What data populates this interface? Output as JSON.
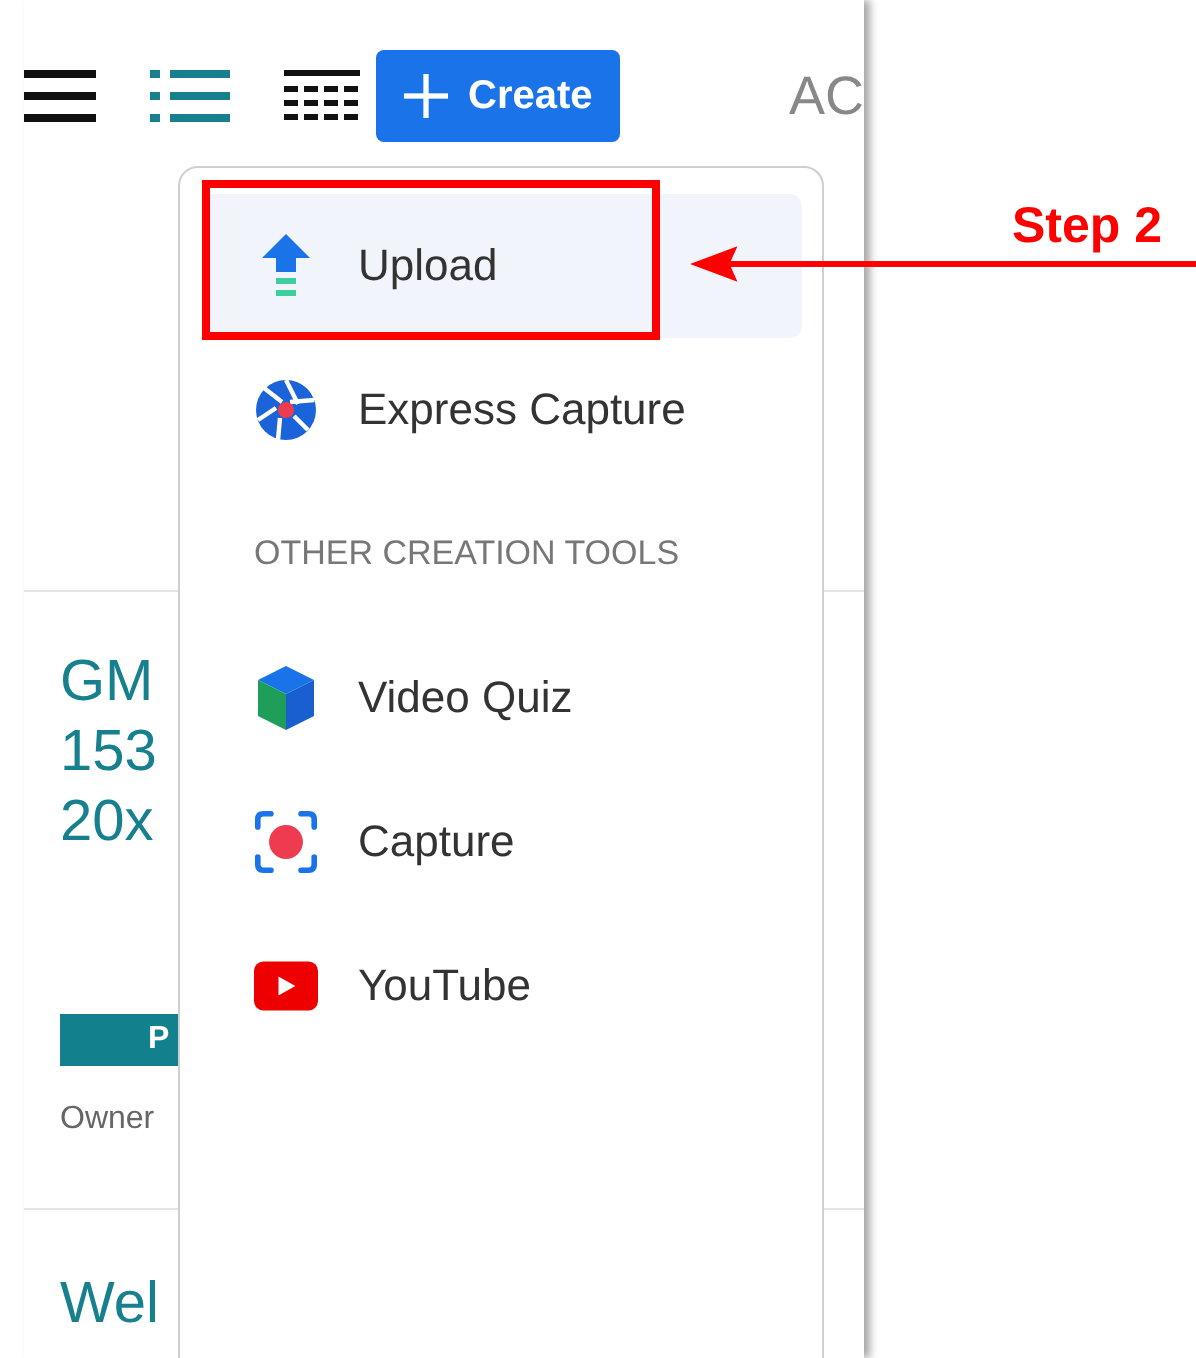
{
  "toolbar": {
    "create_button": {
      "label": "Create"
    },
    "partial_heading": "AC"
  },
  "cards": [
    {
      "title_lines": [
        "GM",
        "153",
        "20x"
      ],
      "badge": "P",
      "owner": "Owner"
    },
    {
      "title_lines": [
        "Wel"
      ]
    }
  ],
  "menu": {
    "items": [
      {
        "kind": "upload",
        "label": "Upload",
        "selected": true
      },
      {
        "kind": "express",
        "label": "Express Capture",
        "selected": false
      }
    ],
    "section_title": "OTHER CREATION TOOLS",
    "tools": [
      {
        "kind": "quiz",
        "label": "Video Quiz",
        "selected": false
      },
      {
        "kind": "capture",
        "label": "Capture",
        "selected": false
      },
      {
        "kind": "youtube",
        "label": "YouTube",
        "selected": false
      }
    ]
  },
  "annotation": {
    "label": "Step 2"
  }
}
